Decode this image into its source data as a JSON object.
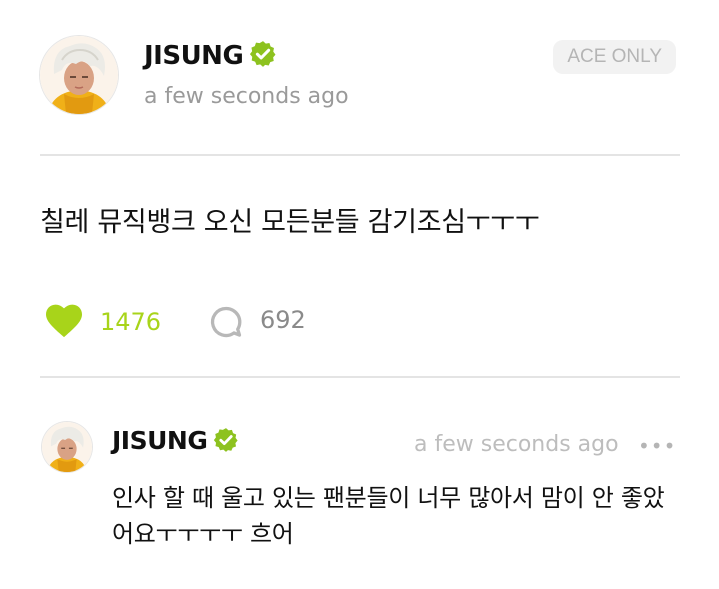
{
  "post": {
    "author": "JISUNG",
    "time": "a few seconds ago",
    "badge": "ACE ONLY",
    "text": "칠레 뮤직뱅크 오신 모든분들 감기조심ㅜㅜㅜ",
    "like_count": "1476",
    "comment_count": "692"
  },
  "comment": {
    "author": "JISUNG",
    "time": "a few seconds ago",
    "more": "•••",
    "text": "인사 할 때 울고 있는 팬분들이 너무 많아서 맘이 안 좋았어요ㅜㅜㅜㅜ 흐어"
  },
  "colors": {
    "accent": "#a8d41a",
    "verified": "#8dc21f",
    "muted": "#9a9a9a",
    "divider": "#e4e4e4"
  },
  "icons": {
    "verified": "verified-badge-icon",
    "like": "heart-icon",
    "comment": "comment-bubble-icon",
    "more": "more-dots-icon"
  }
}
